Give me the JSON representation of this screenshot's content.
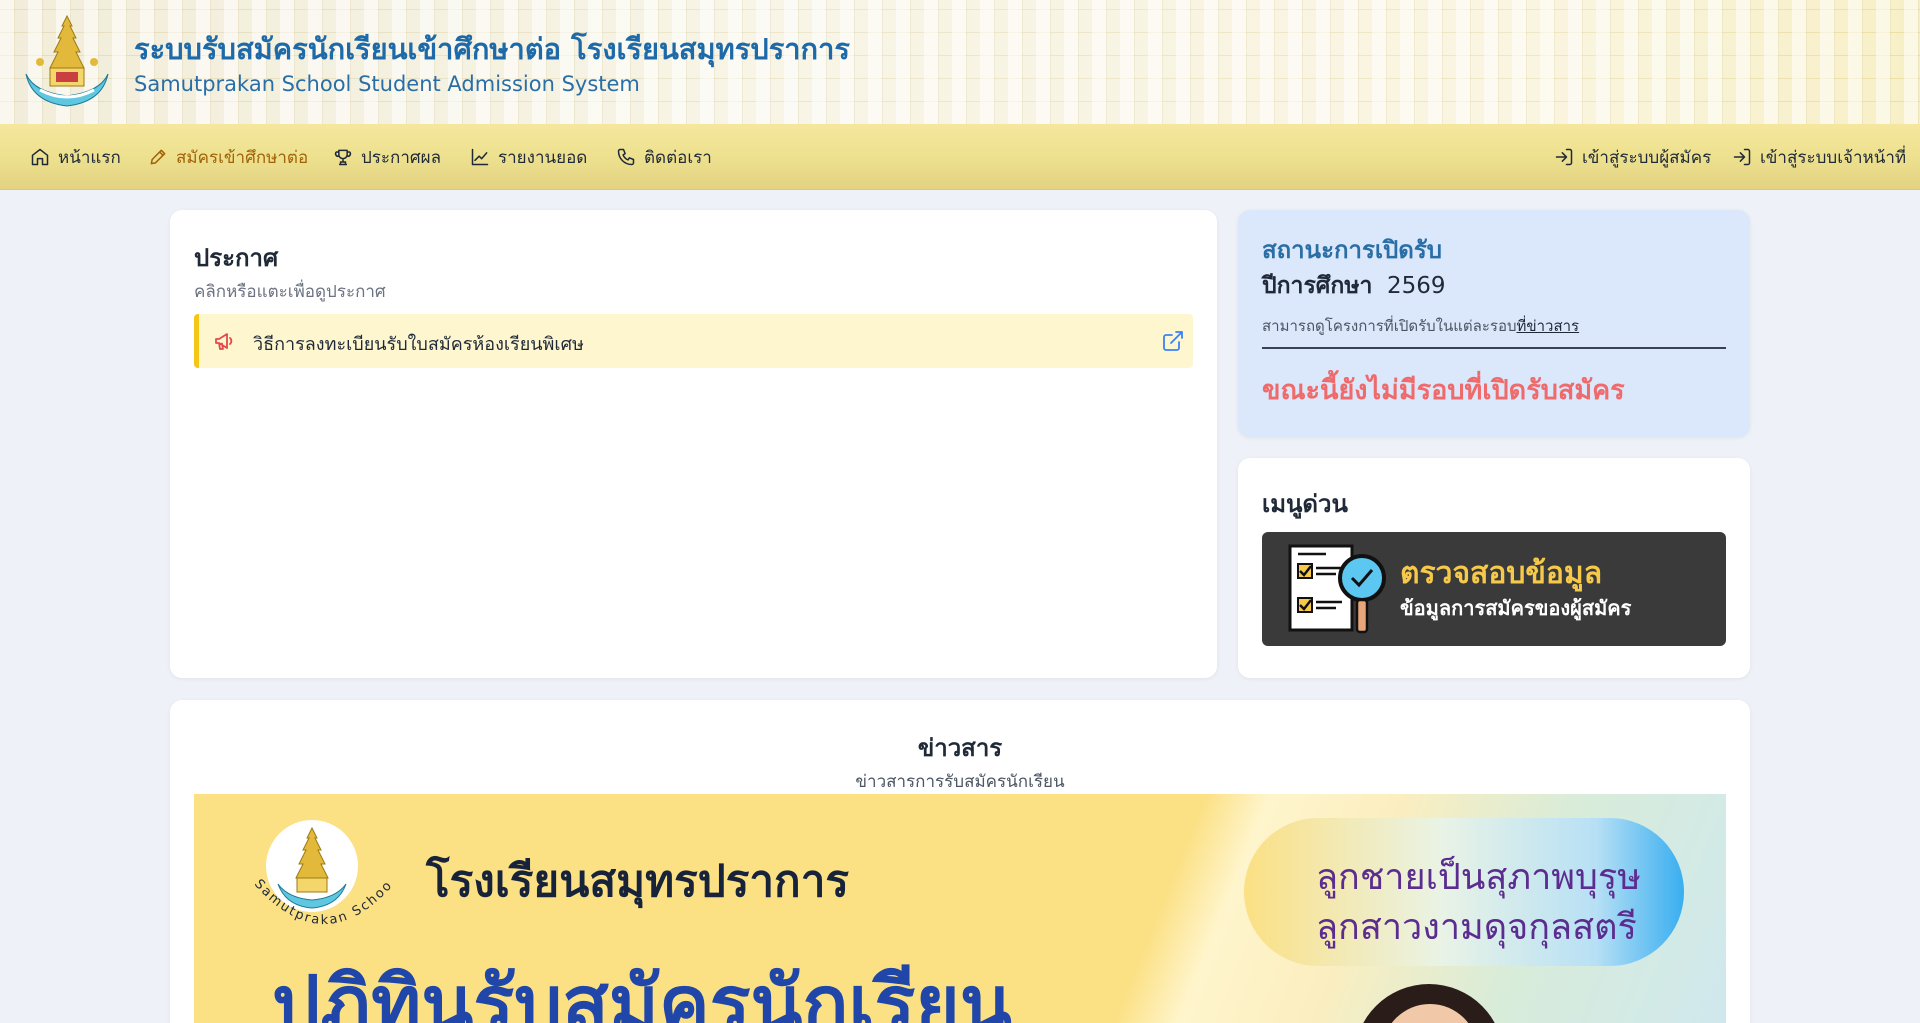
{
  "header": {
    "title_th": "ระบบรับสมัครนักเรียนเข้าศึกษาต่อ โรงเรียนสมุทรปราการ",
    "title_en": "Samutprakan School Student Admission System"
  },
  "nav": {
    "home": "หน้าแรก",
    "apply": "สมัครเข้าศึกษาต่อ",
    "results": "ประกาศผล",
    "report": "รายงานยอด",
    "contact": "ติดต่อเรา",
    "login_applicant": "เข้าสู่ระบบผู้สมัคร",
    "login_staff": "เข้าสู่ระบบเจ้าหน้าที่"
  },
  "announcements": {
    "title": "ประกาศ",
    "subtitle": "คลิกหรือแตะเพื่อดูประกาศ",
    "items": [
      {
        "text": "วิธีการลงทะเบียนรับใบสมัครห้องเรียนพิเศษ"
      }
    ]
  },
  "status": {
    "title": "สถานะการเปิดรับ",
    "year_label": "ปีการศึกษา",
    "year_value": "2569",
    "note_prefix": "สามารถดูโครงการที่เปิดรับในแต่ละรอบ",
    "note_link": "ที่ข่าวสาร",
    "closed_message": "ขณะนี้ยังไม่มีรอบที่เปิดรับสมัคร"
  },
  "quick_menu": {
    "title": "เมนูด่วน",
    "banner_line1": "ตรวจสอบข้อมูล",
    "banner_line2": "ข้อมูลการสมัครของผู้สมัคร"
  },
  "news": {
    "title": "ข่าวสาร",
    "subtitle": "ข่าวสารการรับสมัครนักเรียน",
    "banner": {
      "school": "โรงเรียนสมุทรปราการ",
      "school_en": "Samutprakan School",
      "headline": "ปฏิทินรับสมัครนักเรียน",
      "motto_1": "ลูกชายเป็นสุภาพบุรุษ",
      "motto_2": "ลูกสาวงามดุจกุลสตรี"
    }
  },
  "colors": {
    "accent_blue": "#2a6ea6",
    "nav_gold": "#ede18f",
    "active_nav": "#a16207",
    "closed_red": "#ef6b6b",
    "status_bg": "#dbe7fb",
    "announce_bg": "#fef6cf"
  },
  "icons": {
    "home": "home-icon",
    "apply": "pencil-icon",
    "results": "trophy-icon",
    "report": "chart-line-icon",
    "contact": "phone-icon",
    "login": "login-icon",
    "announce": "megaphone-icon",
    "external": "external-link-icon"
  }
}
